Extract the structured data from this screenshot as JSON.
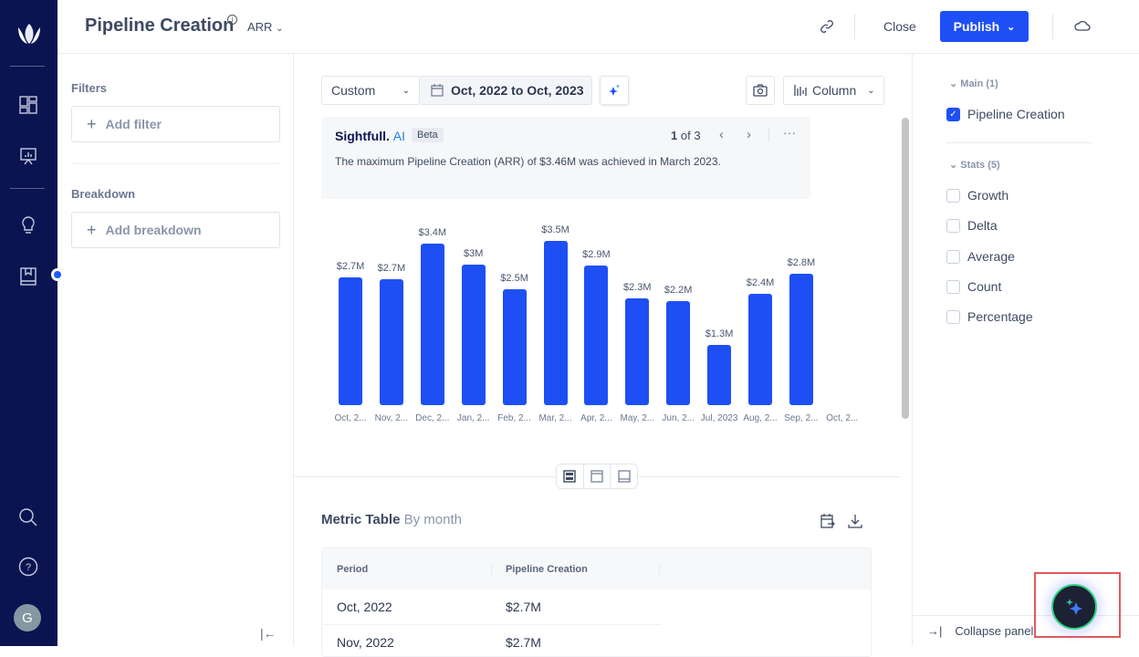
{
  "header": {
    "title": "Pipeline Creation",
    "metric_type": "ARR",
    "close_label": "Close",
    "publish_label": "Publish"
  },
  "left_panel": {
    "filters_title": "Filters",
    "add_filter": "Add filter",
    "breakdown_title": "Breakdown",
    "add_breakdown": "Add breakdown"
  },
  "rail": {
    "avatar_initial": "G"
  },
  "toolbar": {
    "range_preset": "Custom",
    "date_range": "Oct, 2022 to Oct, 2023",
    "chart_type": "Column"
  },
  "ai_card": {
    "brand": "Sightfull.",
    "brand_ai": "AI",
    "badge": "Beta",
    "page_current": "1",
    "page_of": "of 3",
    "message": "The maximum Pipeline Creation (ARR) of $3.46M was achieved in March 2023."
  },
  "chart_data": {
    "type": "bar",
    "title": "",
    "xlabel": "",
    "ylabel": "",
    "categories": [
      "Oct, 2...",
      "Nov, 2...",
      "Dec, 2...",
      "Jan, 2...",
      "Feb, 2...",
      "Mar, 2...",
      "Apr, 2...",
      "May, 2...",
      "Jun, 2...",
      "Jul, 2023",
      "Aug, 2...",
      "Sep, 2...",
      "Oct, 2..."
    ],
    "values": [
      2.7,
      2.65,
      3.4,
      2.96,
      2.45,
      3.46,
      2.94,
      2.25,
      2.2,
      1.26,
      2.35,
      2.76,
      null
    ],
    "labels": [
      "$2.7M",
      "$2.7M",
      "$3.4M",
      "$3M",
      "$2.5M",
      "$3.5M",
      "$2.9M",
      "$2.3M",
      "$2.2M",
      "$1.3M",
      "$2.4M",
      "$2.8M",
      ""
    ],
    "ylim": [
      0,
      3.46
    ],
    "grid": false,
    "color": "#1e4ff5"
  },
  "metric_table": {
    "title": "Metric Table",
    "subtitle": "By month",
    "columns": [
      "Period",
      "Pipeline Creation"
    ],
    "rows": [
      {
        "period": "Oct, 2022",
        "value": "$2.7M"
      },
      {
        "period": "Nov, 2022",
        "value": "$2.7M"
      }
    ]
  },
  "right_panel": {
    "main_group": "Main (1)",
    "main_item": "Pipeline Creation",
    "stats_group": "Stats (5)",
    "stats": [
      "Growth",
      "Delta",
      "Average",
      "Count",
      "Percentage"
    ],
    "collapse_label": "Collapse panel"
  }
}
